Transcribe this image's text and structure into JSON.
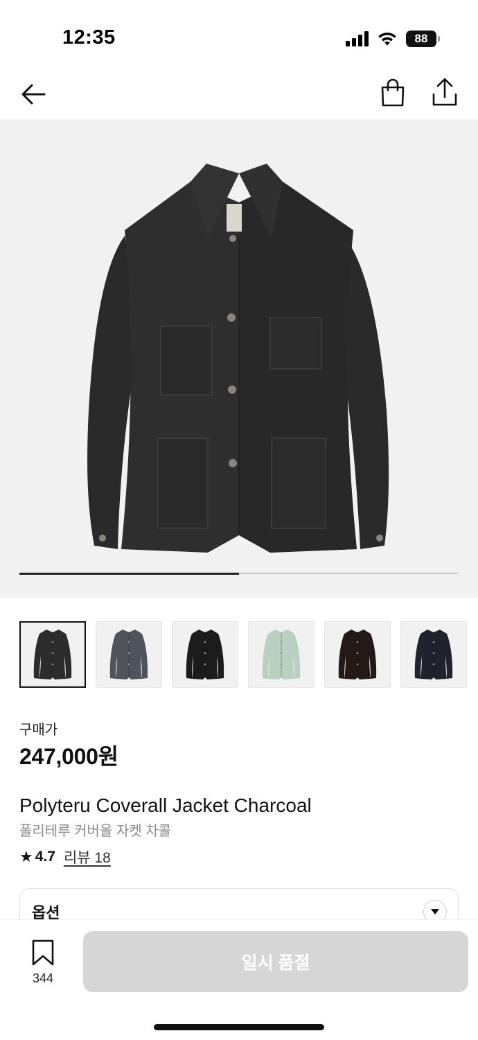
{
  "status_bar": {
    "time": "12:35",
    "battery": "88"
  },
  "nav": {
    "back_icon": "arrow-left-icon",
    "cart_icon": "shopping-bag-icon",
    "share_icon": "share-icon"
  },
  "gallery": {
    "progress": 0.5,
    "image_count": 6,
    "current_index": 1
  },
  "thumbnails": [
    {
      "color": "#2c2c2c",
      "label": "charcoal"
    },
    {
      "color": "#4f535c",
      "label": "grey blue"
    },
    {
      "color": "#1c1c1c",
      "label": "black"
    },
    {
      "color": "#b9cfc0",
      "label": "mint"
    },
    {
      "color": "#231a17",
      "label": "dark brown"
    },
    {
      "color": "#20232d",
      "label": "navy"
    }
  ],
  "price": {
    "label": "구매가",
    "value": "247,000원"
  },
  "product": {
    "name": "Polyteru Coverall Jacket Charcoal",
    "name_ko": "폴리테루 커버올 자켓 차콜",
    "rating": "4.7",
    "review_link": "리뷰 18"
  },
  "option": {
    "label": "옵션"
  },
  "bottom": {
    "wish_count": "344",
    "button_label": "일시 품절"
  },
  "colors": {
    "accent": "#111111",
    "soldout_button": "#d6d6d6",
    "hero_bg": "#f1f1f1"
  }
}
